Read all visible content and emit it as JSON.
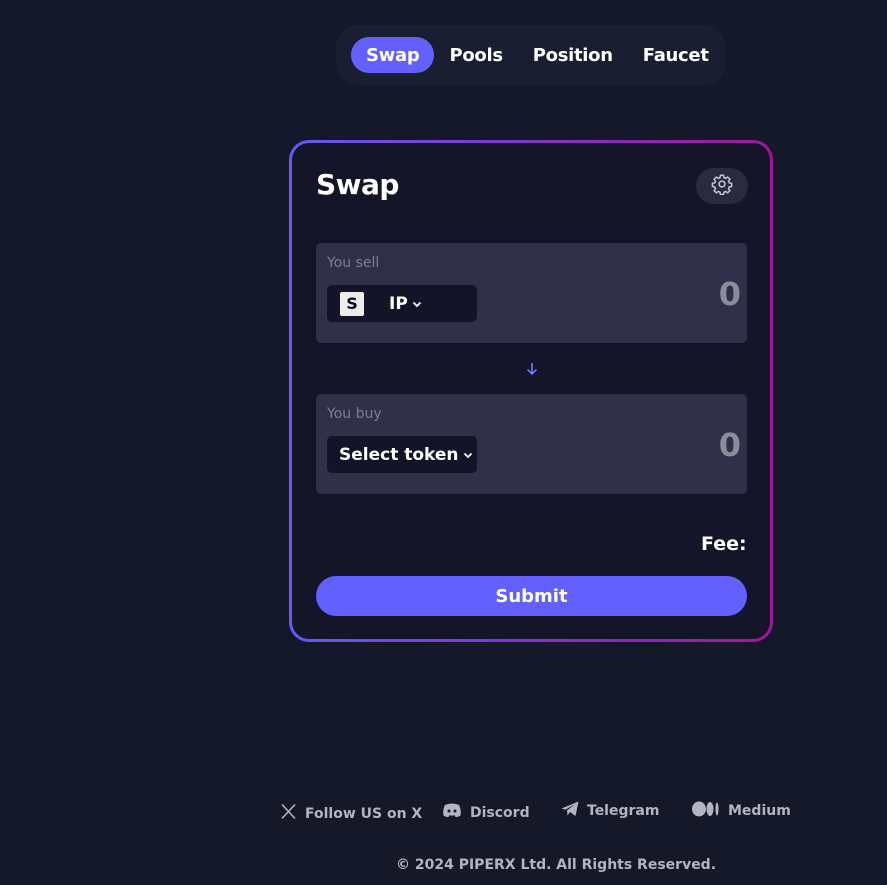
{
  "nav": {
    "tabs": [
      {
        "label": "Swap",
        "active": true
      },
      {
        "label": "Pools",
        "active": false
      },
      {
        "label": "Position",
        "active": false
      },
      {
        "label": "Faucet",
        "active": false
      }
    ]
  },
  "swap": {
    "title": "Swap",
    "sell": {
      "label": "You sell",
      "token": "IP",
      "token_logo": "S",
      "amount": "0"
    },
    "buy": {
      "label": "You buy",
      "token": "Select token",
      "amount": "0"
    },
    "fee_label": "Fee:",
    "submit_label": "Submit"
  },
  "footer": {
    "links": [
      {
        "label": "Follow US on X",
        "icon": "x-icon"
      },
      {
        "label": "Discord",
        "icon": "discord-icon"
      },
      {
        "label": "Telegram",
        "icon": "telegram-icon"
      },
      {
        "label": "Medium",
        "icon": "medium-icon"
      }
    ],
    "copyright": "© 2024 PIPERX Ltd. All Rights Reserved."
  },
  "colors": {
    "background": "#141829",
    "accent": "#6360ff",
    "panel": "#303049",
    "border_gradient_start": "#6459f6",
    "border_gradient_end": "#a0169d"
  }
}
